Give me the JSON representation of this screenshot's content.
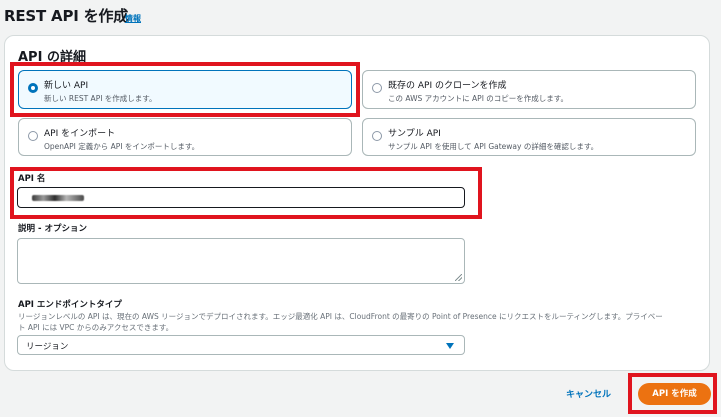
{
  "header": {
    "title": "REST API を作成",
    "info_link": "情報"
  },
  "details": {
    "title": "API の詳細",
    "options": [
      {
        "label": "新しい API",
        "description": "新しい REST API を作成します。",
        "selected": true
      },
      {
        "label": "既存の API のクローンを作成",
        "description": "この AWS アカウントに API のコピーを作成します。",
        "selected": false
      },
      {
        "label": "API をインポート",
        "description": "OpenAPI 定義から API をインポートします。",
        "selected": false
      },
      {
        "label": "サンプル API",
        "description": "サンプル API を使用して API Gateway の詳細を確認します。",
        "selected": false
      }
    ],
    "api_name": {
      "label": "API 名",
      "value": ""
    },
    "description": {
      "label": "説明 - オプション",
      "value": ""
    },
    "endpoint_type": {
      "label": "API エンドポイントタイプ",
      "help_line1": "リージョンレベルの API は、現在の AWS リージョンでデプロイされます。エッジ最適化 API は、CloudFront の最寄りの Point of Presence にリクエストをルーティングします。プライベー",
      "help_line2": "ト API には VPC からのみアクセスできます。",
      "selected": "リージョン"
    }
  },
  "footer": {
    "cancel_label": "キャンセル",
    "create_label": "API を作成"
  },
  "colors": {
    "accent": "#0073bb",
    "primary_button": "#ec7211",
    "highlight": "#e0141e"
  }
}
